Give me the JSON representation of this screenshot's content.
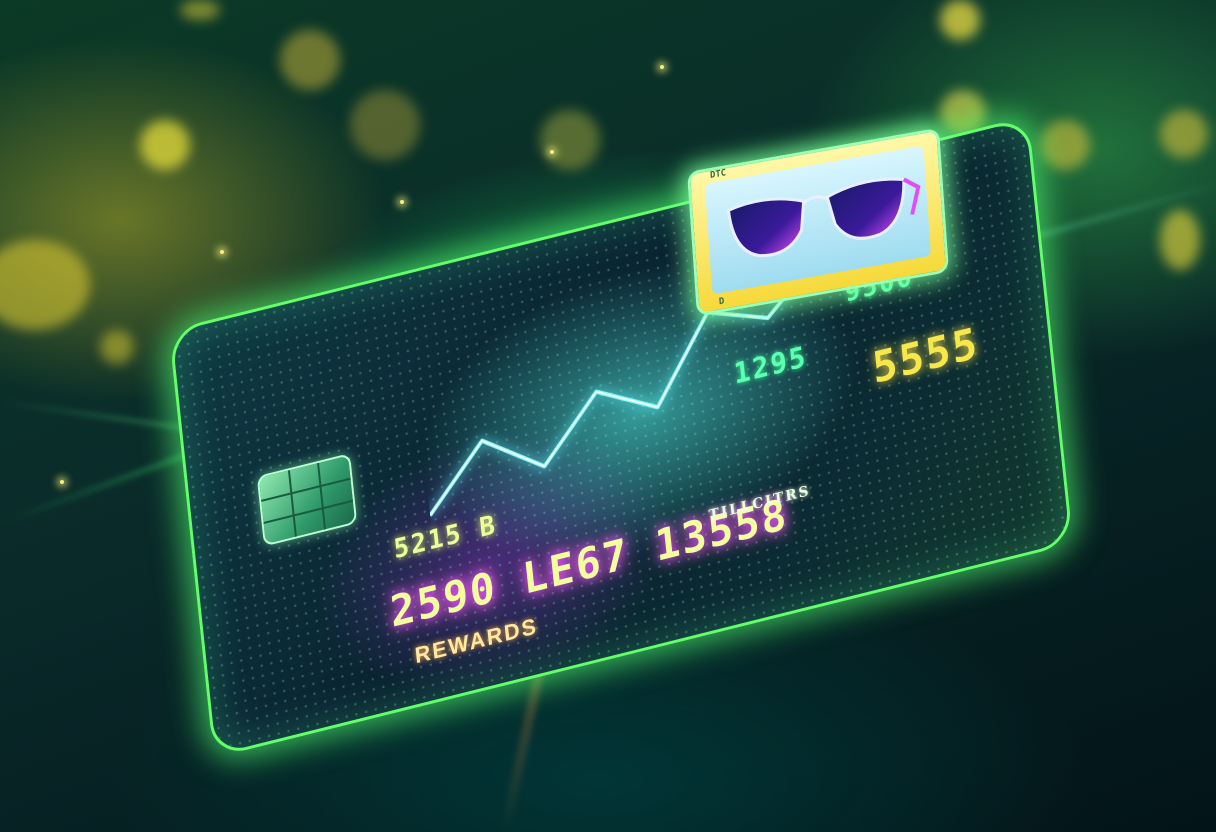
{
  "card": {
    "number_top_right": "5555",
    "number_mid_right": "1295",
    "number_top_small": "9500",
    "number_partial": "5215 B",
    "number_main": "2590 LE67 13558",
    "sub_label": "TILLCITRS",
    "rewards_label": "REWARDS"
  },
  "tag": {
    "label_top": "DTC",
    "label_bottom": "D"
  },
  "colors": {
    "card_border": "#63ff6a",
    "glow_green": "#3bff6e",
    "accent_yellow": "#f6e84a",
    "accent_magenta": "#e24cff",
    "accent_cyan": "#5cf6ff"
  },
  "icons": {
    "chip": "emv-chip-icon",
    "product": "sunglasses-icon",
    "graph": "trend-line-icon"
  }
}
